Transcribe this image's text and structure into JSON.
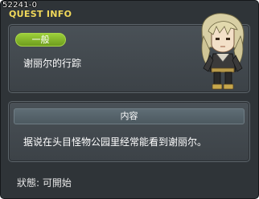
{
  "window": {
    "id_text": "52241-0",
    "title": "QUEST INFO"
  },
  "quest": {
    "category_badge": "一般",
    "name": "谢丽尔的行踪"
  },
  "content": {
    "header": "内容",
    "text": "据说在头目怪物公园里经常能看到谢丽尔。"
  },
  "status": {
    "text": "狀態:  可開始"
  },
  "npc": {
    "icon": "npc-portrait"
  },
  "colors": {
    "title": "#f0d85a",
    "badge": "#7fb42a",
    "panel": "#444b50"
  }
}
